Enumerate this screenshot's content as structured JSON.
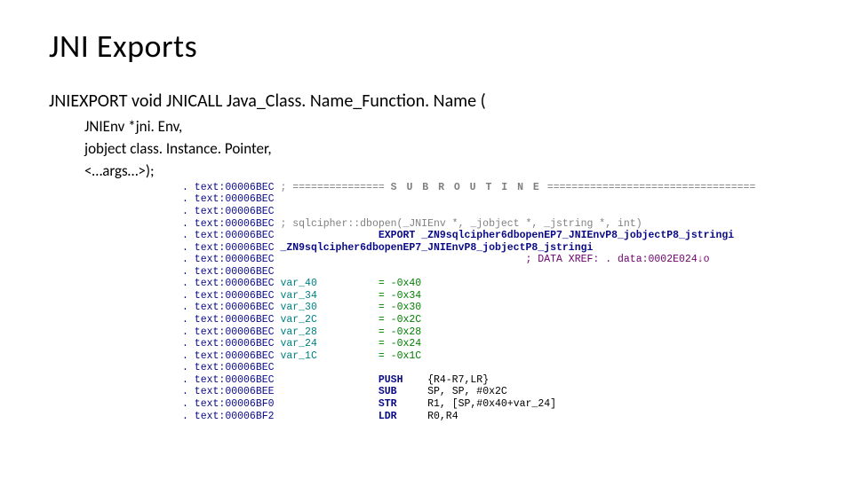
{
  "title": "JNI Exports",
  "declaration": "JNIEXPORT void JNICALL Java_Class. Name_Function. Name (",
  "args": [
    "JNIEnv *jni. Env,",
    "jobject class. Instance. Pointer,",
    "<…args…>);"
  ],
  "addr_prefix": ". text:",
  "subroutine_banner": "S U B R O U T I N E",
  "proto_comment": "; sqlcipher::dbopen(_JNIEnv *, _jobject *, _jstring *, int)",
  "export_line": "EXPORT _ZN9sqlcipher6dbopenEP7_JNIEnvP8_jobjectP8_jstringi",
  "symbol": "_ZN9sqlcipher6dbopenEP7_JNIEnvP8_jobjectP8_jstringi",
  "xref": "; DATA XREF: . data:0002E024↓o",
  "vars": [
    {
      "name": "var_40",
      "eq": "= -0x40"
    },
    {
      "name": "var_34",
      "eq": "= -0x34"
    },
    {
      "name": "var_30",
      "eq": "= -0x30"
    },
    {
      "name": "var_2C",
      "eq": "= -0x2C"
    },
    {
      "name": "var_28",
      "eq": "= -0x28"
    },
    {
      "name": "var_24",
      "eq": "= -0x24"
    },
    {
      "name": "var_1C",
      "eq": "= -0x1C"
    }
  ],
  "instr": [
    {
      "addr": "00006BEC",
      "op": "PUSH",
      "args": "{R4-R7,LR}"
    },
    {
      "addr": "00006BEE",
      "op": "SUB",
      "args": "SP, SP, #0x2C"
    },
    {
      "addr": "00006BF0",
      "op": "STR",
      "args": "R1, [SP,#0x40+var_24]"
    },
    {
      "addr": "00006BF2",
      "op": "LDR",
      "args": "R0,R4"
    }
  ]
}
